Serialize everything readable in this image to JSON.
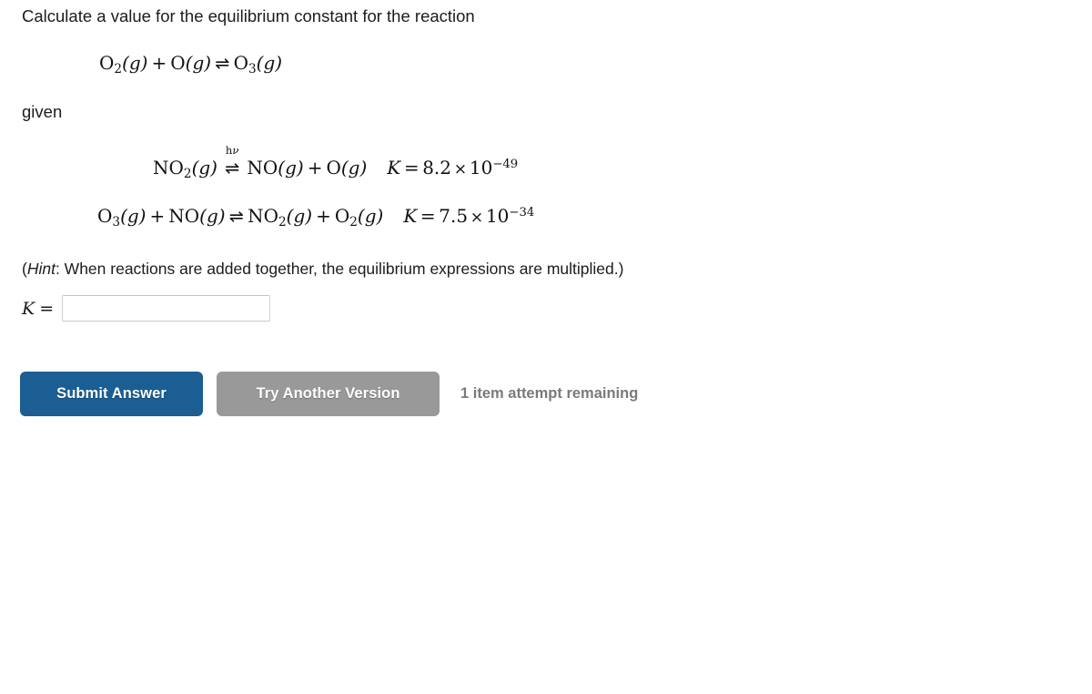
{
  "question": {
    "prompt": "Calculate a value for the equilibrium constant for the reaction",
    "given_label": "given",
    "hint_word": "Hint",
    "hint_text": ": When reactions are added together, the equilibrium expressions are multiplied.)",
    "hint_open_paren": "("
  },
  "target_reaction": {
    "reactant_1": "O",
    "reactant_1_sub": "2",
    "reactant_1_state": "(g)",
    "plus": "+",
    "reactant_2": "O",
    "reactant_2_state": "(g)",
    "arrow": "⇌",
    "product_1": "O",
    "product_1_sub": "3",
    "product_1_state": "(g)"
  },
  "given_reactions": [
    {
      "reactant_1": "NO",
      "reactant_1_sub": "2",
      "reactant_1_state": "(g)",
      "arrow": "⇌",
      "arrow_label_h": "h",
      "arrow_label_nu": "ν",
      "product_1": "NO",
      "product_1_state": "(g)",
      "plus": "+",
      "product_2": "O",
      "product_2_state": "(g)",
      "k_symbol": "K",
      "equals": "=",
      "k_mantissa": "8.2",
      "k_times": "×",
      "k_base": "10",
      "k_exponent": "−49"
    },
    {
      "reactant_1": "O",
      "reactant_1_sub": "3",
      "reactant_1_state": "(g)",
      "plus_left": "+",
      "reactant_2": "NO",
      "reactant_2_state": "(g)",
      "arrow": "⇌",
      "product_1": "NO",
      "product_1_sub": "2",
      "product_1_state": "(g)",
      "plus_right": "+",
      "product_2": "O",
      "product_2_sub": "2",
      "product_2_state": "(g)",
      "k_symbol": "K",
      "equals": "=",
      "k_mantissa": "7.5",
      "k_times": "×",
      "k_base": "10",
      "k_exponent": "−34"
    }
  ],
  "answer": {
    "label": "K",
    "equals": "=",
    "value": "",
    "placeholder": ""
  },
  "actions": {
    "submit_label": "Submit Answer",
    "try_another_label": "Try Another Version",
    "attempts_status": "1 item attempt remaining"
  },
  "colors": {
    "submit_button": "#1a5e94",
    "try_another_button": "#999999",
    "status_text": "#7a7a7a",
    "input_border": "#cfcfcf",
    "page_background": "#ffffff"
  }
}
